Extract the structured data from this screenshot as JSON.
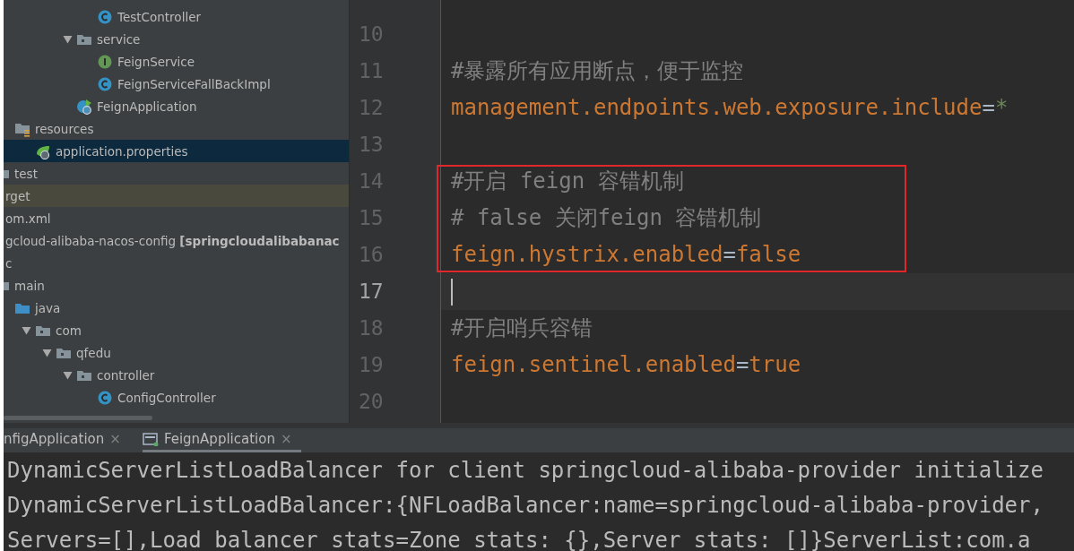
{
  "project_tree": {
    "items": [
      {
        "label": "TestController",
        "kind": "class",
        "selected": false,
        "excluded": false
      },
      {
        "label": "service",
        "kind": "package",
        "expanded": true,
        "selected": false,
        "excluded": false,
        "children": [
          {
            "label": "FeignService",
            "kind": "interface",
            "selected": false,
            "excluded": false
          },
          {
            "label": "FeignServiceFallBackImpl",
            "kind": "class",
            "selected": false,
            "excluded": false
          }
        ]
      },
      {
        "label": "FeignApplication",
        "kind": "boot-class",
        "selected": false,
        "excluded": false
      },
      {
        "label": "resources",
        "kind": "resources-folder",
        "selected": false,
        "excluded": false,
        "children": [
          {
            "label": "application.properties",
            "kind": "properties",
            "selected": true,
            "excluded": false
          }
        ]
      },
      {
        "label": "test",
        "kind": "folder",
        "selected": false,
        "excluded": false
      },
      {
        "label": "rget",
        "selected": false,
        "excluded": true
      },
      {
        "label": "om.xml",
        "selected": false,
        "excluded": false
      },
      {
        "label": "gcloud-alibaba-nacos-config **[springcloudalibabanac**",
        "selected": false,
        "excluded": false,
        "children": [
          {
            "label": "c",
            "selected": false,
            "excluded": false,
            "children": [
              {
                "label": "main",
                "kind": "folder",
                "selected": false,
                "excluded": false,
                "children": [
                  {
                    "label": "java",
                    "kind": "source-folder",
                    "selected": false,
                    "excluded": false,
                    "children": [
                      {
                        "label": "com",
                        "kind": "package",
                        "expanded": true,
                        "selected": false,
                        "excluded": false,
                        "children": [
                          {
                            "label": "qfedu",
                            "kind": "package",
                            "expanded": true,
                            "selected": false,
                            "excluded": false,
                            "children": [
                              {
                                "label": "controller",
                                "kind": "package",
                                "expanded": true,
                                "selected": false,
                                "excluded": false,
                                "children": [
                                  {
                                    "label": "ConfigController",
                                    "kind": "class",
                                    "selected": false,
                                    "excluded": false
                                  }
                                ]
                              }
                            ]
                          }
                        ]
                      }
                    ]
                  }
                ]
              }
            ]
          }
        ]
      }
    ]
  },
  "editor": {
    "lines": [
      {
        "number": "10",
        "current": false
      },
      {
        "number": "11",
        "current": false,
        "boxed": false,
        "tokens": [
          {
            "text": "#暴露所有应用断点，便于监控",
            "kind": "comment"
          }
        ]
      },
      {
        "number": "12",
        "current": false,
        "boxed": false,
        "tokens": [
          {
            "text": "management.endpoints.web.exposure.include",
            "kind": "key"
          },
          {
            "text": "=",
            "kind": "separator"
          },
          {
            "text": "*",
            "kind": "string"
          }
        ]
      },
      {
        "number": "13",
        "current": false
      },
      {
        "number": "14",
        "current": false,
        "boxed": true,
        "tokens": [
          {
            "text": "#开启 feign 容错机制",
            "kind": "comment"
          }
        ]
      },
      {
        "number": "15",
        "current": false,
        "boxed": true,
        "tokens": [
          {
            "text": "# false 关闭feign 容错机制",
            "kind": "comment"
          }
        ]
      },
      {
        "number": "16",
        "current": false,
        "boxed": true,
        "tokens": [
          {
            "text": "feign.hystrix.enabled",
            "kind": "key"
          },
          {
            "text": "=",
            "kind": "separator"
          },
          {
            "text": "false",
            "kind": "literal"
          }
        ]
      },
      {
        "number": "17",
        "current": true,
        "boxed": false
      },
      {
        "number": "18",
        "current": false,
        "boxed": false,
        "tokens": [
          {
            "text": "#开启哨兵容错",
            "kind": "comment"
          }
        ]
      },
      {
        "number": "19",
        "current": false,
        "boxed": false,
        "tokens": [
          {
            "text": "feign.sentinel.enabled",
            "kind": "key"
          },
          {
            "text": "=",
            "kind": "separator"
          },
          {
            "text": "true",
            "kind": "literal"
          }
        ]
      },
      {
        "number": "20",
        "current": false
      }
    ]
  },
  "run_panel": {
    "tabs": [
      {
        "label": "nfigApplication",
        "close": "×",
        "selected": false
      },
      {
        "label": "FeignApplication",
        "close": "×",
        "selected": true
      }
    ],
    "console_lines": [
      "DynamicServerListLoadBalancer for client springcloud-alibaba-provider initialize",
      "DynamicServerListLoadBalancer:{NFLoadBalancer:name=springcloud-alibaba-provider,",
      "Servers=[],Load balancer stats=Zone stats: {},Server stats: []}ServerList:com.a"
    ]
  }
}
